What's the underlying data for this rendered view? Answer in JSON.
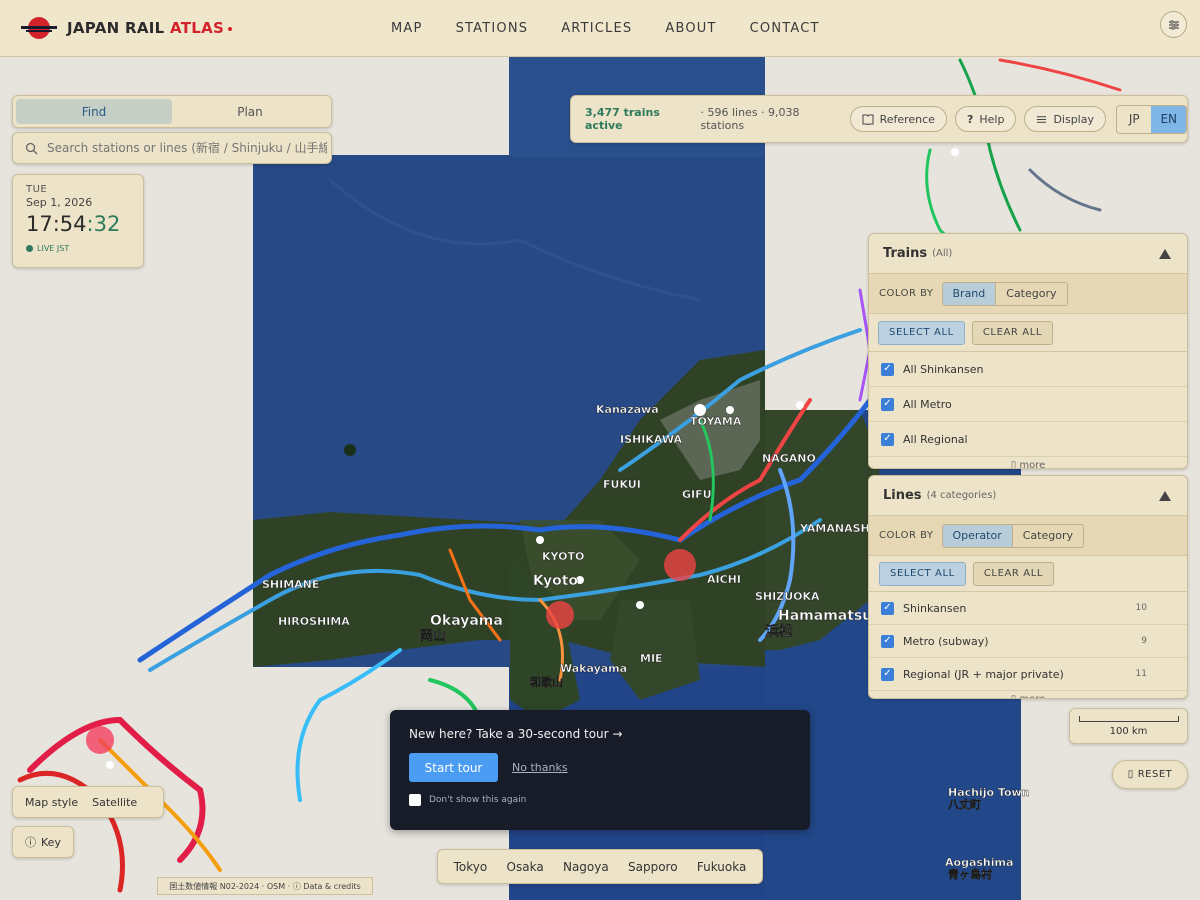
{
  "header": {
    "brand_main": "JAPAN RAIL ",
    "brand_accent": "ATLAS",
    "nav": [
      {
        "label": "MAP"
      },
      {
        "label": "STATIONS"
      },
      {
        "label": "ARTICLES"
      },
      {
        "label": "ABOUT"
      },
      {
        "label": "CONTACT"
      }
    ],
    "menu_icon": "sliders-icon"
  },
  "find_plan": {
    "find_label": "Find",
    "plan_label": "Plan",
    "active": "Find"
  },
  "search": {
    "placeholder": "Search stations or lines (新宿 / Shinjuku / 山手線)",
    "icon": "search-icon"
  },
  "clock": {
    "weekday": "TUE",
    "date": "Sep 1, 2026",
    "hhmm": "17:54",
    "sep": ":",
    "seconds": "32",
    "live_label": "LIVE JST"
  },
  "stats": {
    "active": "3,477 trains active",
    "meta": "· 596 lines · 9,038 stations",
    "reference_label": "Reference",
    "help_label": "Help",
    "display_label": "Display",
    "lang_jp": "JP",
    "lang_en": "EN",
    "lang_selected": "EN"
  },
  "trains_panel": {
    "title": "Trains",
    "subtitle": "(All)",
    "color_by_label": "COLOR BY",
    "color_by_options": [
      "Brand",
      "Category"
    ],
    "color_by_selected": "Brand",
    "select_all": "SELECT ALL",
    "clear_all": "CLEAR ALL",
    "items": [
      {
        "label": "All Shinkansen",
        "checked": true
      },
      {
        "label": "All Metro",
        "checked": true
      },
      {
        "label": "All Regional",
        "checked": true
      }
    ],
    "more": "more"
  },
  "lines_panel": {
    "title": "Lines",
    "subtitle": "(4 categories)",
    "color_by_label": "COLOR BY",
    "color_by_options": [
      "Operator",
      "Category"
    ],
    "color_by_selected": "Operator",
    "select_all": "SELECT ALL",
    "clear_all": "CLEAR ALL",
    "items": [
      {
        "label": "Shinkansen",
        "count": "10",
        "checked": true
      },
      {
        "label": "Metro (subway)",
        "count": "9",
        "checked": true
      },
      {
        "label": "Regional (JR + major private)",
        "count": "11",
        "checked": true
      }
    ],
    "more": "more"
  },
  "scale": {
    "label": "100 km"
  },
  "reset": {
    "label": "RESET"
  },
  "tour": {
    "question": "New here? Take a 30-second tour →",
    "start": "Start tour",
    "decline": "No thanks",
    "dont_show": "Don't show this again"
  },
  "map_style": {
    "label": "Map style",
    "value": "Satellite"
  },
  "key": {
    "label": "Key"
  },
  "attribution": "国土数値情報 N02-2024 · OSM · ⓘ Data & credits",
  "cities": [
    "Tokyo",
    "Osaka",
    "Nagoya",
    "Sapporo",
    "Fukuoka"
  ],
  "map_labels": [
    {
      "text": "Kanazawa",
      "tone": "light"
    },
    {
      "text": "TOYAMA",
      "tone": "light"
    },
    {
      "text": "ISHIKAWA",
      "tone": "light"
    },
    {
      "text": "NAGANO",
      "tone": "light"
    },
    {
      "text": "GIFU",
      "tone": "light"
    },
    {
      "text": "FUKUI",
      "tone": "light"
    },
    {
      "text": "KYOTO",
      "tone": "light"
    },
    {
      "text": "Kyoto",
      "tone": "light"
    },
    {
      "text": "SHIMANE",
      "tone": "light"
    },
    {
      "text": "HIROSHIMA",
      "tone": "light"
    },
    {
      "text": "Okayama",
      "tone": "light"
    },
    {
      "text": "岡山",
      "tone": "light"
    },
    {
      "text": "AICHI",
      "tone": "light"
    },
    {
      "text": "MIE",
      "tone": "light"
    },
    {
      "text": "YAMANASHI",
      "tone": "light"
    },
    {
      "text": "SHIZUOKA",
      "tone": "light"
    },
    {
      "text": "Hamamatsu",
      "tone": "light"
    },
    {
      "text": "浜松",
      "tone": "light"
    },
    {
      "text": "Wakayama",
      "tone": "light"
    },
    {
      "text": "和歌山",
      "tone": "light"
    },
    {
      "text": "Hachijo Town",
      "tone": "light"
    },
    {
      "text": "八丈町",
      "tone": "light"
    },
    {
      "text": "Aogashima",
      "tone": "light"
    },
    {
      "text": "青ヶ島村",
      "tone": "light"
    }
  ],
  "colors": {
    "panel_bg": "#ede3c8",
    "accent_red": "#d2232a",
    "live_green": "#2e7a5c",
    "toggle_blue": "#7fb6e6",
    "tour_bg": "#181c28",
    "sea": "#1f3f78",
    "land": "#2e3f26"
  }
}
